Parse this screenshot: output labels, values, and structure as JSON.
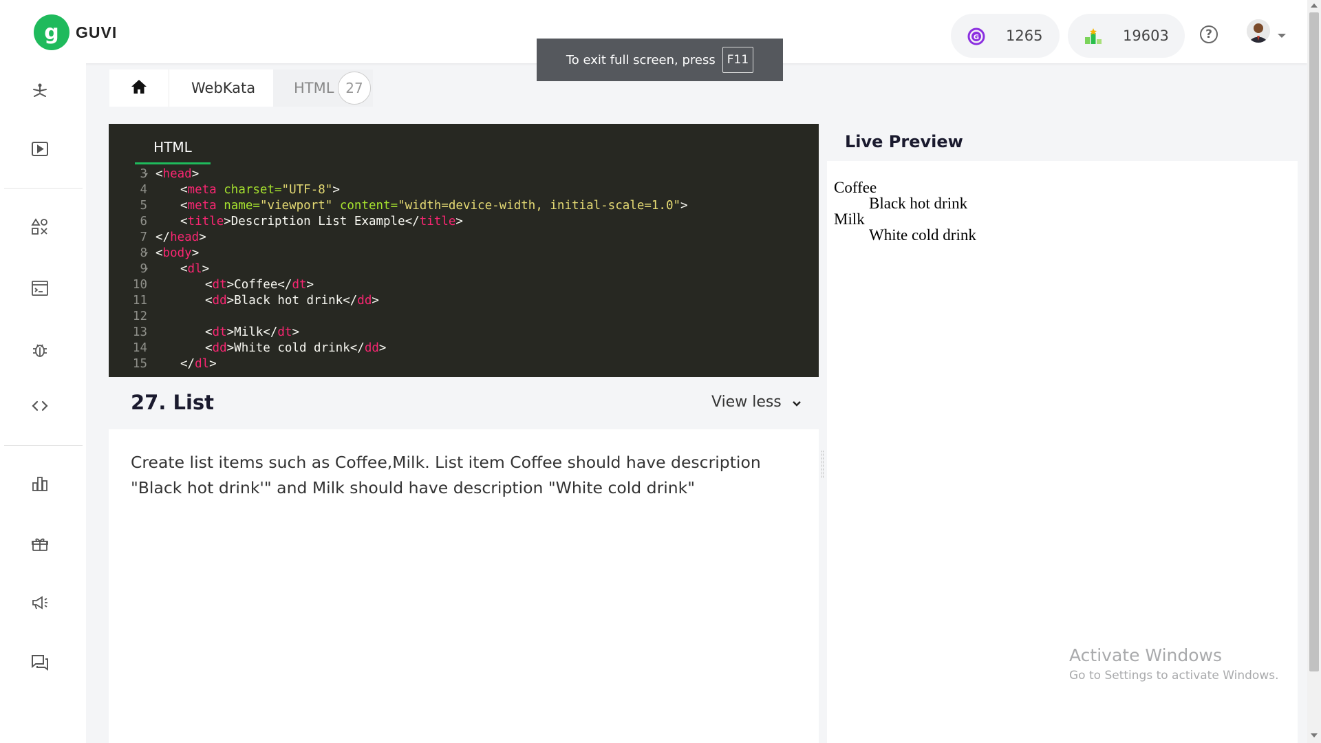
{
  "brand": {
    "name": "GUVI",
    "logo_letter": "g"
  },
  "header": {
    "gems": {
      "icon": "guvi-coin-icon",
      "value": "1265"
    },
    "rank": {
      "icon": "leaderboard-podium-icon",
      "value": "19603"
    },
    "help_icon": "question-circle-icon",
    "avatar": "user-avatar"
  },
  "fullscreen_toast": {
    "text": "To exit full screen, press",
    "key": "F11"
  },
  "sidebar": {
    "items": [
      {
        "name": "yoga-pose-icon"
      },
      {
        "name": "play-video-icon"
      },
      {
        "name": "shapes-icon"
      },
      {
        "name": "terminal-window-icon"
      },
      {
        "name": "bug-icon"
      },
      {
        "name": "code-brackets-icon"
      },
      {
        "name": "bar-chart-icon"
      },
      {
        "name": "gift-box-icon"
      },
      {
        "name": "megaphone-icon"
      },
      {
        "name": "chat-bubbles-icon"
      }
    ]
  },
  "breadcrumb": {
    "home_icon": "home-icon",
    "section": "WebKata",
    "category": "HTML",
    "count": "27"
  },
  "editor": {
    "tab": "HTML",
    "lines": [
      {
        "n": "3",
        "fold": true,
        "indent": 0,
        "parts": [
          [
            "p",
            "<"
          ],
          [
            "t",
            "head"
          ],
          [
            "p",
            ">"
          ]
        ]
      },
      {
        "n": "4",
        "fold": false,
        "indent": 1,
        "parts": [
          [
            "p",
            "<"
          ],
          [
            "t",
            "meta"
          ],
          [
            "p",
            " "
          ],
          [
            "a",
            "charset="
          ],
          [
            "s",
            "\"UTF-8\""
          ],
          [
            "p",
            ">"
          ]
        ]
      },
      {
        "n": "5",
        "fold": false,
        "indent": 1,
        "parts": [
          [
            "p",
            "<"
          ],
          [
            "t",
            "meta"
          ],
          [
            "p",
            " "
          ],
          [
            "a",
            "name="
          ],
          [
            "s",
            "\"viewport\""
          ],
          [
            "p",
            " "
          ],
          [
            "a",
            "content="
          ],
          [
            "s",
            "\"width=device-width, initial-scale=1.0\""
          ],
          [
            "p",
            ">"
          ]
        ]
      },
      {
        "n": "6",
        "fold": false,
        "indent": 1,
        "parts": [
          [
            "p",
            "<"
          ],
          [
            "t",
            "title"
          ],
          [
            "p",
            ">Description List Example</"
          ],
          [
            "t",
            "title"
          ],
          [
            "p",
            ">"
          ]
        ]
      },
      {
        "n": "7",
        "fold": false,
        "indent": 0,
        "parts": [
          [
            "p",
            "</"
          ],
          [
            "t",
            "head"
          ],
          [
            "p",
            ">"
          ]
        ]
      },
      {
        "n": "8",
        "fold": true,
        "indent": 0,
        "parts": [
          [
            "p",
            "<"
          ],
          [
            "t",
            "body"
          ],
          [
            "p",
            ">"
          ]
        ]
      },
      {
        "n": "9",
        "fold": true,
        "indent": 1,
        "parts": [
          [
            "p",
            "<"
          ],
          [
            "t",
            "dl"
          ],
          [
            "p",
            ">"
          ]
        ]
      },
      {
        "n": "10",
        "fold": false,
        "indent": 2,
        "parts": [
          [
            "p",
            "<"
          ],
          [
            "t",
            "dt"
          ],
          [
            "p",
            ">Coffee</"
          ],
          [
            "t",
            "dt"
          ],
          [
            "p",
            ">"
          ]
        ]
      },
      {
        "n": "11",
        "fold": false,
        "indent": 2,
        "parts": [
          [
            "p",
            "<"
          ],
          [
            "t",
            "dd"
          ],
          [
            "p",
            ">Black hot drink</"
          ],
          [
            "t",
            "dd"
          ],
          [
            "p",
            ">"
          ]
        ]
      },
      {
        "n": "12",
        "fold": false,
        "indent": 0,
        "parts": []
      },
      {
        "n": "13",
        "fold": false,
        "indent": 2,
        "parts": [
          [
            "p",
            "<"
          ],
          [
            "t",
            "dt"
          ],
          [
            "p",
            ">Milk</"
          ],
          [
            "t",
            "dt"
          ],
          [
            "p",
            ">"
          ]
        ]
      },
      {
        "n": "14",
        "fold": false,
        "indent": 2,
        "parts": [
          [
            "p",
            "<"
          ],
          [
            "t",
            "dd"
          ],
          [
            "p",
            ">White cold drink</"
          ],
          [
            "t",
            "dd"
          ],
          [
            "p",
            ">"
          ]
        ]
      },
      {
        "n": "15",
        "fold": false,
        "indent": 1,
        "parts": [
          [
            "p",
            "</"
          ],
          [
            "t",
            "dl"
          ],
          [
            "p",
            ">"
          ]
        ]
      }
    ]
  },
  "problem": {
    "title": "27. List",
    "toggle_label": "View less",
    "description": "Create list items such as Coffee,Milk. List item Coffee should have description \"Black hot drink'\" and Milk should have description \"White cold drink\""
  },
  "preview": {
    "title": "Live Preview",
    "items": [
      {
        "term": "Coffee",
        "desc": "Black hot drink"
      },
      {
        "term": "Milk",
        "desc": "White cold drink"
      }
    ]
  },
  "watermark": {
    "line1": "Activate Windows",
    "line2": "Go to Settings to activate Windows."
  },
  "colors": {
    "accent": "#1fba5c",
    "editor_bg": "#272822",
    "tag": "#f92672",
    "attr": "#a6e22e",
    "string": "#e6db74"
  }
}
